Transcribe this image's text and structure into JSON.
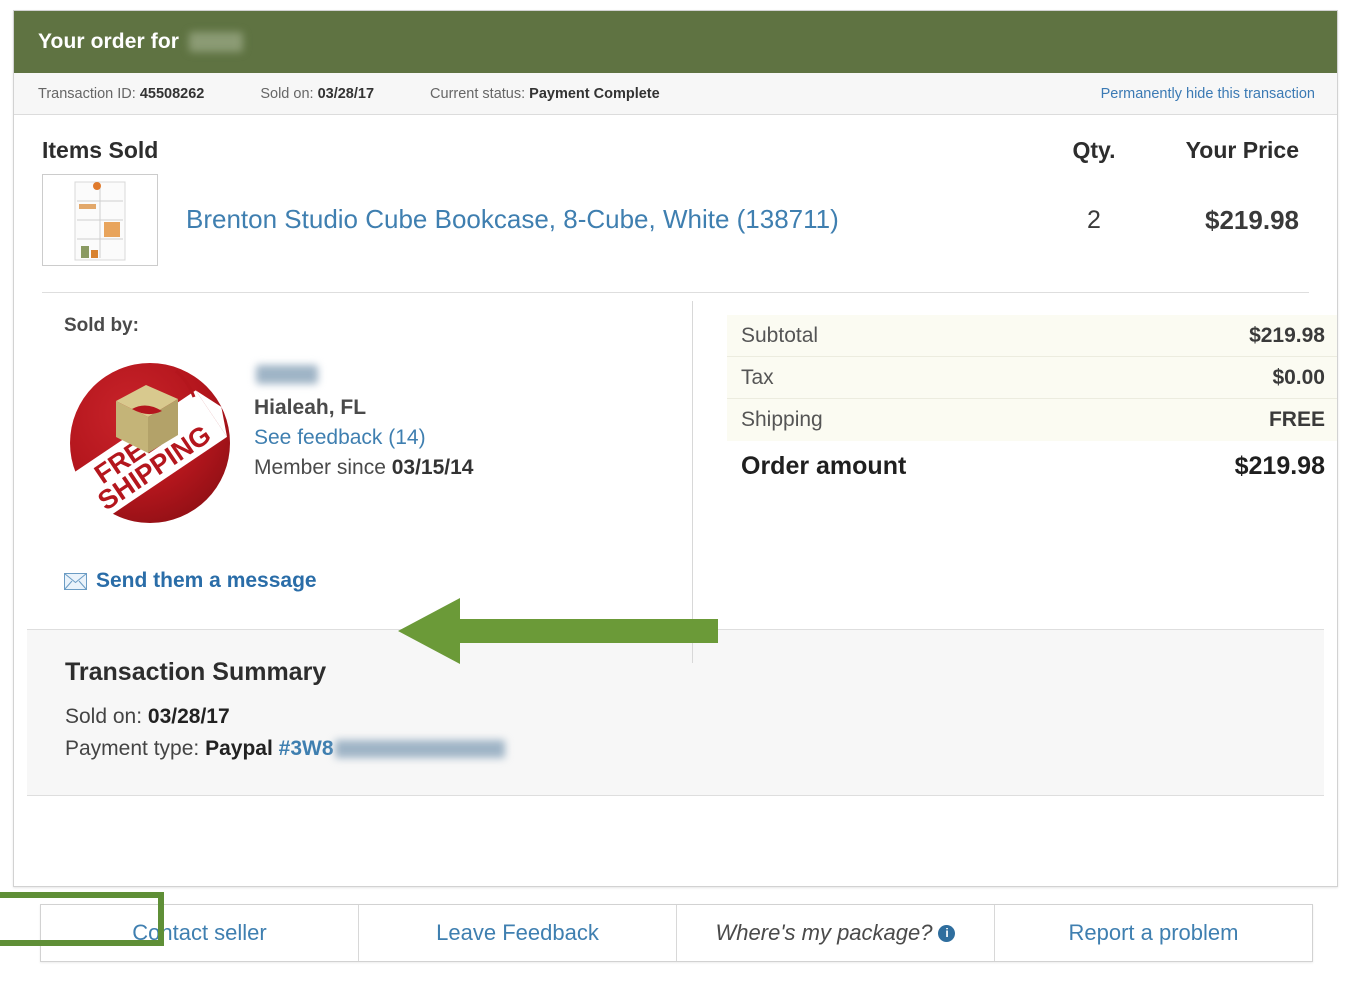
{
  "header": {
    "title": "Your order for",
    "buyer_name_redacted": true
  },
  "transaction_bar": {
    "items": [
      {
        "label": "Transaction ID:",
        "value": "45508262"
      },
      {
        "label": "Sold on:",
        "value": "03/28/17"
      },
      {
        "label": "Current status:",
        "value": "Payment Complete"
      }
    ],
    "hide_link": "Permanently hide this transaction"
  },
  "items_sold": {
    "headers": {
      "title": "Items Sold",
      "qty": "Qty.",
      "price": "Your Price"
    },
    "rows": [
      {
        "title": "Brenton Studio Cube Bookcase, 8-Cube, White (138711)",
        "qty": "2",
        "price": "$219.98",
        "thumbnail": "bookcase-thumbnail"
      }
    ]
  },
  "seller": {
    "sold_by_label": "Sold by:",
    "name_redacted": true,
    "avatar": "free-shipping-badge",
    "location": "Hialeah, FL",
    "feedback_link": "See feedback (14)",
    "member_since_label": "Member since",
    "member_since_value": "03/15/14",
    "message_link": "Send them a message",
    "message_icon": "envelope-icon"
  },
  "totals": {
    "rows": [
      {
        "label": "Subtotal",
        "value": "$219.98"
      },
      {
        "label": "Tax",
        "value": "$0.00"
      },
      {
        "label": "Shipping",
        "value": "FREE"
      }
    ],
    "total_label": "Order amount",
    "total_value": "$219.98"
  },
  "summary": {
    "title": "Transaction Summary",
    "sold_on_label": "Sold on:",
    "sold_on_value": "03/28/17",
    "payment_label": "Payment type:",
    "payment_method": "Paypal",
    "payment_ref_prefix": "#3W8",
    "payment_ref_redacted": true
  },
  "actions": [
    {
      "label": "Contact seller",
      "highlighted": true
    },
    {
      "label": "Leave Feedback",
      "highlighted": false
    },
    {
      "label": "Where's my package?",
      "highlighted": false,
      "icon": "info-icon",
      "italic": true
    },
    {
      "label": "Report a problem",
      "highlighted": false
    }
  ],
  "annotation": {
    "arrow": "green-left-arrow",
    "highlight_box": "green-rectangle-around-contact-seller"
  },
  "colors": {
    "header_green": "#5f7342",
    "annotation_green": "#6b9a38",
    "link_blue": "#3f7fb0",
    "totals_bg": "#fbfbf2",
    "summary_bg": "#f7f7f7"
  }
}
